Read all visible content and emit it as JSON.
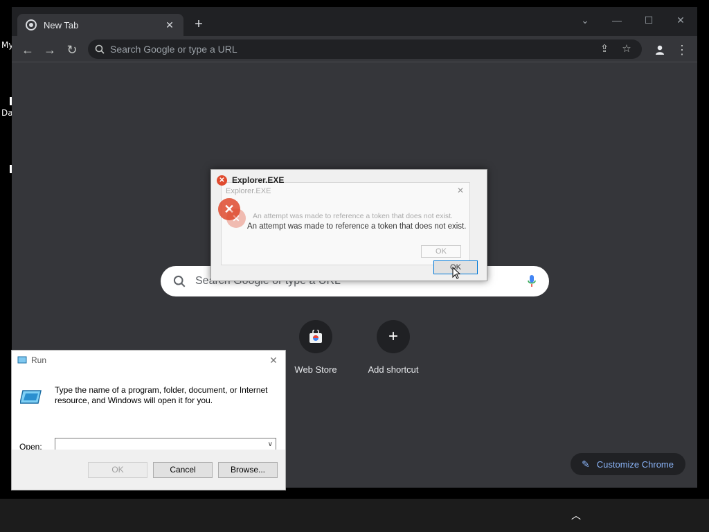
{
  "desktop": {
    "label_my": "My",
    "label_da": "Da"
  },
  "chrome": {
    "tab_title": "New Tab",
    "new_tab_symbol": "+",
    "omnibox_placeholder": "Search Google or type a URL",
    "ntp": {
      "search_placeholder": "Search Google or type a URL",
      "shortcuts": [
        {
          "label": "Web Store"
        },
        {
          "label": "Add shortcut"
        }
      ],
      "customize_label": "Customize Chrome"
    }
  },
  "explorer_dialog": {
    "title": "Explorer.EXE",
    "message": "An attempt was made to reference a token that does not exist.",
    "ok_label": "OK",
    "ghost": {
      "title": "Explorer.EXE",
      "message": "An attempt was made to reference a token that does not exist.",
      "ok_label": "OK"
    }
  },
  "run_dialog": {
    "title": "Run",
    "description": "Type the name of a program, folder, document, or Internet resource, and Windows will open it for you.",
    "open_label": "Open:",
    "input_value": "",
    "ok_label": "OK",
    "cancel_label": "Cancel",
    "browse_label": "Browse..."
  },
  "colors": {
    "chrome_bg": "#35363a",
    "titlebar_bg": "#202124",
    "accent_blue": "#8ab4f8",
    "error_red": "#e04b2f"
  }
}
